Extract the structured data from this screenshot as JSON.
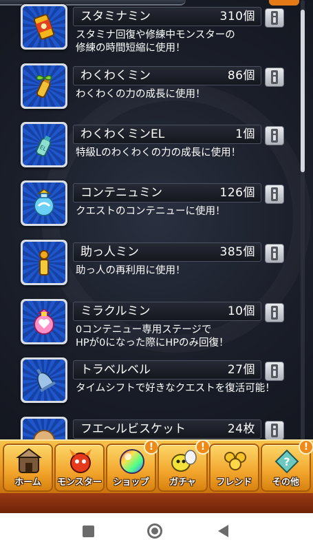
{
  "items": [
    {
      "name": "スタミナミン",
      "count": "310個",
      "desc": "スタミナ回復や修練中モンスターの\n修練の時間短縮に使用！",
      "icon": "stamina-can-icon"
    },
    {
      "name": "わくわくミン",
      "count": "86個",
      "desc": "わくわくの力の成長に使用！",
      "icon": "sprout-bottle-icon"
    },
    {
      "name": "わくわくミンEL",
      "count": "1個",
      "desc": "特級Lのわくわくの力の成長に使用！",
      "icon": "el-bottle-icon"
    },
    {
      "name": "コンテニュミン",
      "count": "126個",
      "desc": "クエストのコンテニューに使用！",
      "icon": "continue-flask-icon"
    },
    {
      "name": "助っ人ミン",
      "count": "385個",
      "desc": "助っ人の再利用に使用！",
      "icon": "helper-bottle-icon"
    },
    {
      "name": "ミラクルミン",
      "count": "10個",
      "desc": "0コンテニュー専用ステージで\nHPが0になった際にHPのみ回復！",
      "icon": "miracle-potion-icon"
    },
    {
      "name": "トラベルベル",
      "count": "27個",
      "desc": "タイムシフトで好きなクエストを復活可能！",
      "icon": "travel-bell-icon"
    },
    {
      "name": "フエ～ルビスケット",
      "count": "24枚",
      "desc": "",
      "icon": "biscuit-icon"
    }
  ],
  "tabs": [
    {
      "label": "ホーム",
      "icon": "home-icon",
      "badge": ""
    },
    {
      "label": "モンスター",
      "icon": "monster-icon",
      "badge": ""
    },
    {
      "label": "ショップ",
      "icon": "orb-icon",
      "badge": "!"
    },
    {
      "label": "ガチャ",
      "icon": "gacha-icon",
      "badge": "!"
    },
    {
      "label": "フレンド",
      "icon": "friend-icon",
      "badge": ""
    },
    {
      "label": "その他",
      "icon": "other-icon",
      "badge": "!"
    }
  ]
}
